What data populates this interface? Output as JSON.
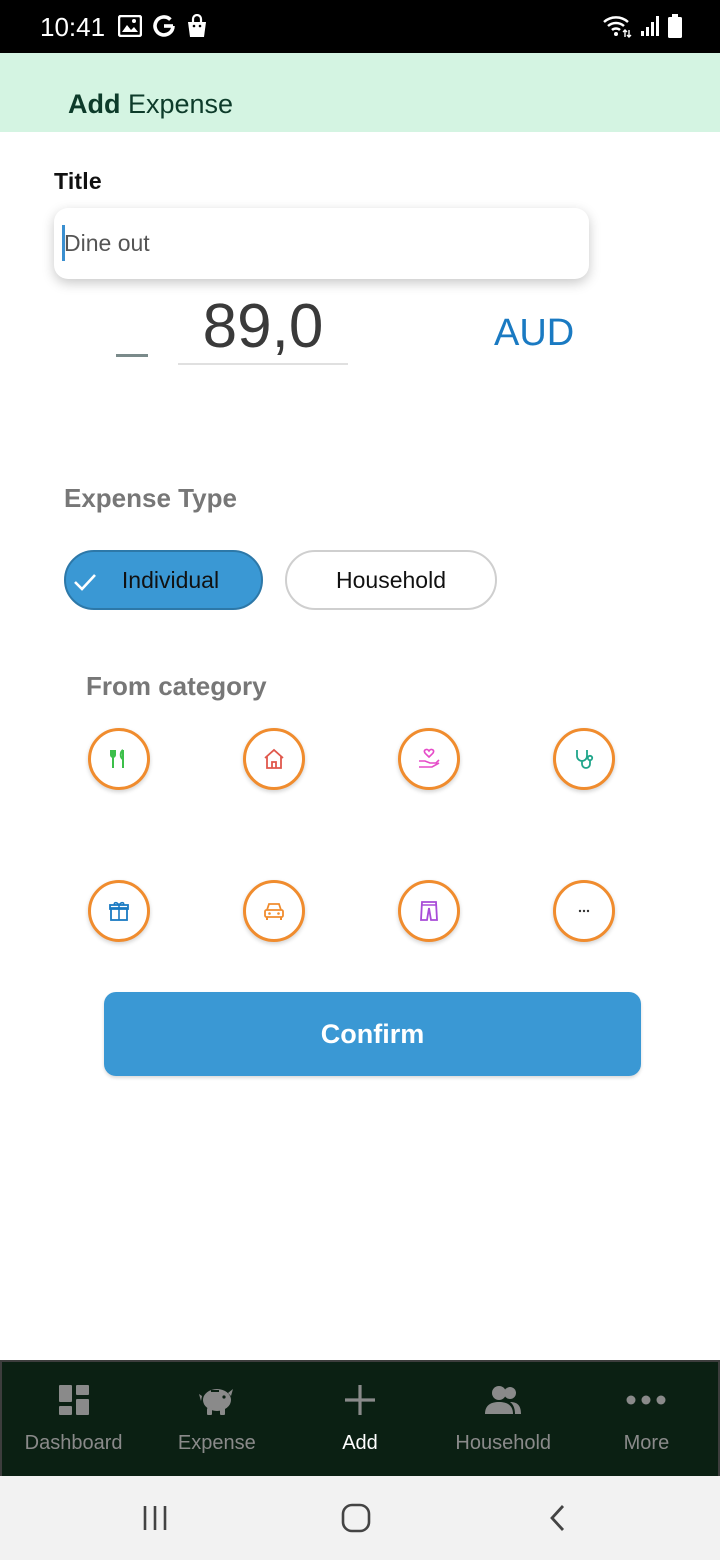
{
  "status_bar": {
    "time": "10:41",
    "left_icons": [
      "image-icon",
      "google-icon",
      "shopping-bag-icon"
    ],
    "right_icons": [
      "wifi-icon",
      "signal-icon",
      "battery-icon"
    ]
  },
  "app_bar": {
    "title_bold": "Add",
    "title_rest": " Expense",
    "background": "#d4f4e2"
  },
  "form": {
    "title_label": "Title",
    "title_value": "Dine out",
    "amount_value": "89,0",
    "currency": "AUD",
    "expense_type_label": "Expense Type",
    "expense_types": [
      {
        "label": "Individual",
        "selected": true
      },
      {
        "label": "Household",
        "selected": false
      }
    ],
    "category_label": "From category",
    "categories": [
      {
        "icon": "fork-knife-icon",
        "color": "#3cbf4a"
      },
      {
        "icon": "home-icon",
        "color": "#e0584c"
      },
      {
        "icon": "hand-heart-icon",
        "color": "#e64bc8"
      },
      {
        "icon": "stethoscope-icon",
        "color": "#1fa58a"
      },
      {
        "icon": "gift-icon",
        "color": "#1a7ac2"
      },
      {
        "icon": "car-icon",
        "color": "#f08c2e"
      },
      {
        "icon": "pants-icon",
        "color": "#a84bd8"
      },
      {
        "icon": "ellipsis-icon",
        "color": "#333333"
      }
    ],
    "confirm_label": "Confirm"
  },
  "bottom_nav": {
    "items": [
      {
        "label": "Dashboard",
        "icon": "dashboard-icon",
        "active": false
      },
      {
        "label": "Expense",
        "icon": "piggy-bank-icon",
        "active": false
      },
      {
        "label": "Add",
        "icon": "plus-icon",
        "active": true
      },
      {
        "label": "Household",
        "icon": "people-icon",
        "active": false
      },
      {
        "label": "More",
        "icon": "more-icon",
        "active": false
      }
    ]
  },
  "system_nav": [
    "recents-icon",
    "home-circle-icon",
    "back-icon"
  ],
  "colors": {
    "accent": "#3a98d4",
    "category_border": "#f08c2e",
    "nav_background": "#0b2013"
  }
}
